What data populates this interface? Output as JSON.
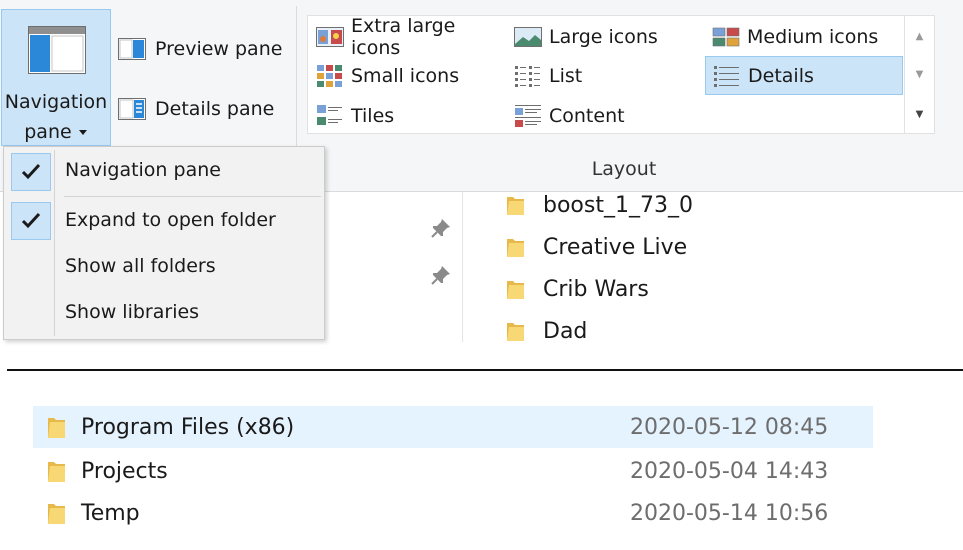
{
  "ribbon": {
    "navigation_pane": {
      "line1": "Navigation",
      "line2": "pane",
      "icon": "navigation-pane-icon"
    },
    "preview_pane": {
      "label": "Preview pane",
      "icon": "preview-pane-icon"
    },
    "details_pane": {
      "label": "Details pane",
      "icon": "details-pane-icon"
    },
    "layout": {
      "group_label": "Layout",
      "options": [
        {
          "label": "Extra large icons",
          "icon": "extra-large-icons-icon",
          "selected": false
        },
        {
          "label": "Large icons",
          "icon": "large-icons-icon",
          "selected": false
        },
        {
          "label": "Medium icons",
          "icon": "medium-icons-icon",
          "selected": false
        },
        {
          "label": "Small icons",
          "icon": "small-icons-icon",
          "selected": false
        },
        {
          "label": "List",
          "icon": "list-icon",
          "selected": false
        },
        {
          "label": "Details",
          "icon": "details-icon",
          "selected": true
        },
        {
          "label": "Tiles",
          "icon": "tiles-icon",
          "selected": false
        },
        {
          "label": "Content",
          "icon": "content-icon",
          "selected": false
        }
      ]
    }
  },
  "dropdown": {
    "items": [
      {
        "label": "Navigation pane",
        "checked": true
      },
      {
        "label": "Expand to open folder",
        "checked": true
      },
      {
        "label": "Show all folders",
        "checked": false
      },
      {
        "label": "Show libraries",
        "checked": false
      }
    ]
  },
  "folders": [
    {
      "name": "boost_1_73_0"
    },
    {
      "name": "Creative Live"
    },
    {
      "name": "Crib Wars"
    },
    {
      "name": "Dad"
    }
  ],
  "detail_rows": [
    {
      "name": "Program Files (x86)",
      "date": "2020-05-12 08:45",
      "selected": true
    },
    {
      "name": "Projects",
      "date": "2020-05-04 14:43",
      "selected": false
    },
    {
      "name": "Temp",
      "date": "2020-05-14 10:56",
      "selected": false
    }
  ],
  "colors": {
    "accent": "#cce4f7",
    "accent_border": "#99c9ef",
    "row_highlight": "#e5f3ff",
    "folder": "#f8d775"
  }
}
